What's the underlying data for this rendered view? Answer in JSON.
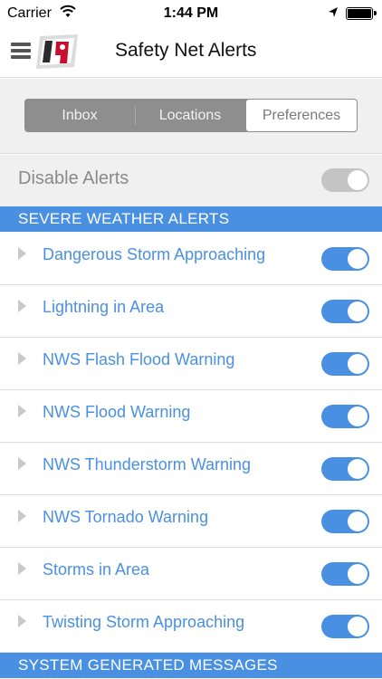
{
  "status_bar": {
    "carrier": "Carrier",
    "time": "1:44 PM"
  },
  "nav": {
    "title": "Safety Net Alerts",
    "logo_text": "19"
  },
  "tabs": [
    {
      "label": "Inbox",
      "active": false
    },
    {
      "label": "Locations",
      "active": false
    },
    {
      "label": "Preferences",
      "active": true
    }
  ],
  "disable_alerts": {
    "label": "Disable Alerts",
    "enabled": false
  },
  "sections": {
    "severe": "SEVERE WEATHER ALERTS",
    "system": "SYSTEM GENERATED MESSAGES"
  },
  "alerts": [
    {
      "label": "Dangerous Storm Approaching",
      "enabled": true
    },
    {
      "label": "Lightning in Area",
      "enabled": true
    },
    {
      "label": "NWS Flash Flood Warning",
      "enabled": true
    },
    {
      "label": "NWS Flood Warning",
      "enabled": true
    },
    {
      "label": "NWS Thunderstorm Warning",
      "enabled": true
    },
    {
      "label": "NWS Tornado Warning",
      "enabled": true
    },
    {
      "label": "Storms in Area",
      "enabled": true
    },
    {
      "label": "Twisting Storm Approaching",
      "enabled": true
    }
  ],
  "colors": {
    "accent": "#4a90e2",
    "toggle_off": "#c4c4c4",
    "segment_bg": "#8e8e8e",
    "logo_red": "#c8102e"
  }
}
